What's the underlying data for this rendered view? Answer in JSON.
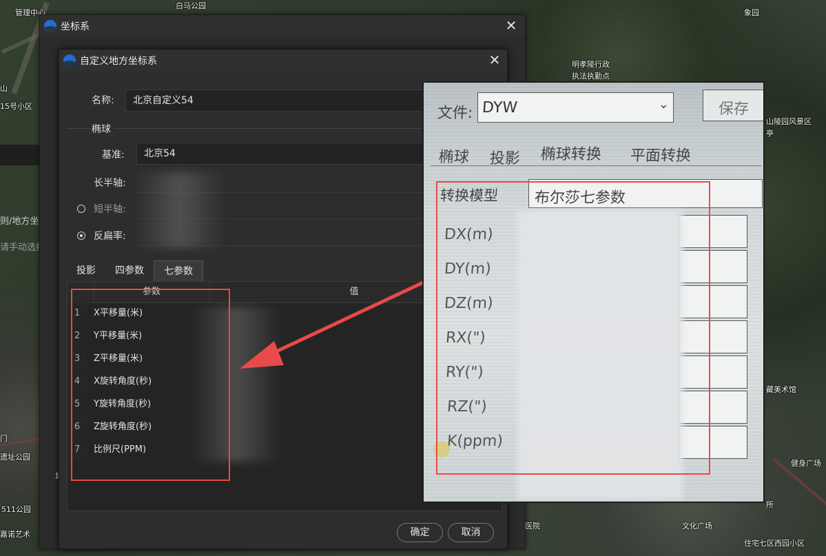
{
  "map": {
    "labels": [
      "管理中心",
      "白马公园",
      "象园",
      "明孝陵行政",
      "执法执勤点",
      "山陵园风景区",
      "亭",
      "藏美术馆",
      "健身广场",
      "所",
      "511公园",
      "嘉诺艺术",
      "医院",
      "文化广场",
      "住宅七区西园小区",
      "门",
      "遗址公园",
      "山",
      "15号小区"
    ]
  },
  "back_dialog": {
    "title": "坐标系",
    "side_texts": [
      "则/地方坐标",
      "请手动选择",
      "地"
    ]
  },
  "front_dialog": {
    "title": "自定义地方坐标系",
    "name_label": "名称:",
    "name_value": "北京自定义54",
    "ellipsoid_group": "椭球",
    "datum_label": "基准:",
    "datum_value": "北京54",
    "semi_major_label": "长半轴:",
    "semi_minor_label": "短半轴:",
    "inv_flattening_label": "反扁率:",
    "semi_minor_selected": false,
    "inv_flattening_selected": true,
    "tabs": [
      "投影",
      "四参数",
      "七参数"
    ],
    "active_tab": "七参数",
    "table": {
      "headers": [
        "参数",
        "值"
      ],
      "rows": [
        {
          "num": "1",
          "name": "X平移量(米)"
        },
        {
          "num": "2",
          "name": "Y平移量(米)"
        },
        {
          "num": "3",
          "name": "Z平移量(米)"
        },
        {
          "num": "4",
          "name": "X旋转角度(秒)"
        },
        {
          "num": "5",
          "name": "Y旋转角度(秒)"
        },
        {
          "num": "6",
          "name": "Z旋转角度(秒)"
        },
        {
          "num": "7",
          "name": "比例尺(PPM)"
        }
      ]
    },
    "ok_label": "确定",
    "cancel_label": "取消"
  },
  "photo": {
    "file_label": "文件:",
    "file_value": "DYW",
    "save_label": "保存",
    "tabs": [
      "椭球",
      "投影",
      "椭球转换",
      "平面转换"
    ],
    "transform_model_label": "转换模型",
    "transform_model_value": "布尔莎七参数",
    "params": [
      "DX(m)",
      "DY(m)",
      "DZ(m)",
      "RX(\")",
      "RY(\")",
      "RZ(\")",
      "K(ppm)"
    ]
  },
  "colors": {
    "highlight": "#e94a4a",
    "dialog_bg": "#2d2d2d",
    "logo": "#1e6fd1"
  }
}
